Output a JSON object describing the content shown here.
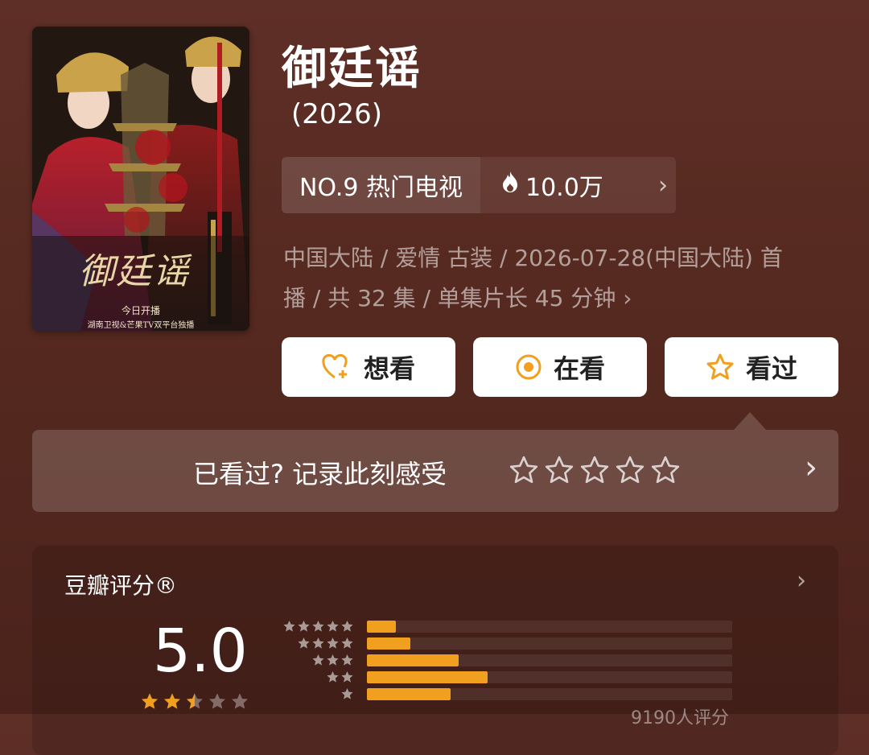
{
  "poster": {
    "title_art": "御廷谣",
    "line1": "今日开播",
    "line2": "湖南卫视&芒果TV双平台独播"
  },
  "title": "御廷谣",
  "year": "(2026)",
  "rank": {
    "label": "NO.9 热门电视",
    "heat": "10.0万"
  },
  "meta_line1": "中国大陆 / 爱情 古装 / 2026-07-28(中国大陆) 首",
  "meta_line2": "播 / 共 32 集 / 单集片长 45 分钟",
  "actions": {
    "want": "想看",
    "watching": "在看",
    "watched": "看过"
  },
  "record": {
    "prompt": "已看过? 记录此刻感受"
  },
  "rating": {
    "label": "豆瓣评分®",
    "score": "5.0",
    "stars": 2.5,
    "distribution": [
      0.08,
      0.12,
      0.25,
      0.33,
      0.23
    ],
    "count_text": "9190人评分"
  },
  "colors": {
    "accent": "#f0a01e",
    "background": "#5a2c24"
  }
}
